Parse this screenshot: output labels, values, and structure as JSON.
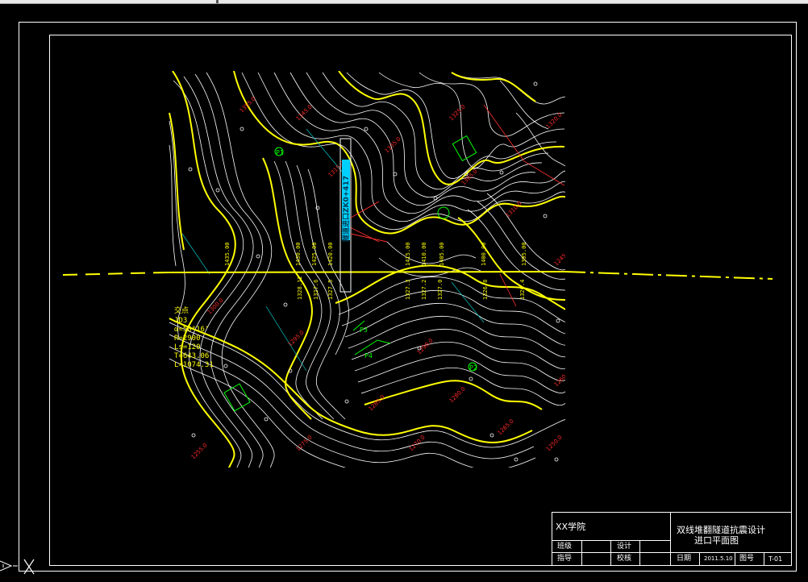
{
  "colors": {
    "background": "#000000",
    "frame": "#ffffff",
    "contour_index": "#ffff00",
    "contour_minor": "#ffffff",
    "axis_line": "#ffff00",
    "labels_red": "#ff2020",
    "labels_green": "#00ff00",
    "labels_cyan": "#00ffff"
  },
  "drawing": {
    "portal_label": "隧道进口ZK0+417",
    "axis_station_labels": [
      "1435.00",
      "1430.00",
      "1425.00",
      "1420.00",
      "1415.00",
      "1410.00",
      "1405.00",
      "1400.00",
      "1395.00"
    ],
    "elevation_labels": [
      "1328.12",
      "1327.6",
      "1327.5",
      "1327.3",
      "1327.2",
      "1327.0",
      "1326.8",
      "1326.4"
    ],
    "curve_table": {
      "title": "交点",
      "lines": [
        "JD3",
        "α=50°16'",
        "R=2900",
        "Ls=120",
        "T=643.06",
        "L=1074.31"
      ]
    },
    "green_marks": [
      "P1",
      "P2",
      "P3",
      "P4"
    ]
  },
  "title_block": {
    "school": "XX学院",
    "project_title": "双线堆翻隧道抗震设计",
    "drawing_name": "进口平面图",
    "row1": [
      "班级",
      "",
      "设计",
      ""
    ],
    "row2": [
      "指导",
      "",
      "校核",
      ""
    ],
    "date_label": "日期",
    "date_value": "2011.5.10",
    "drawing_no_label": "图号",
    "drawing_no_value": "T-01"
  }
}
